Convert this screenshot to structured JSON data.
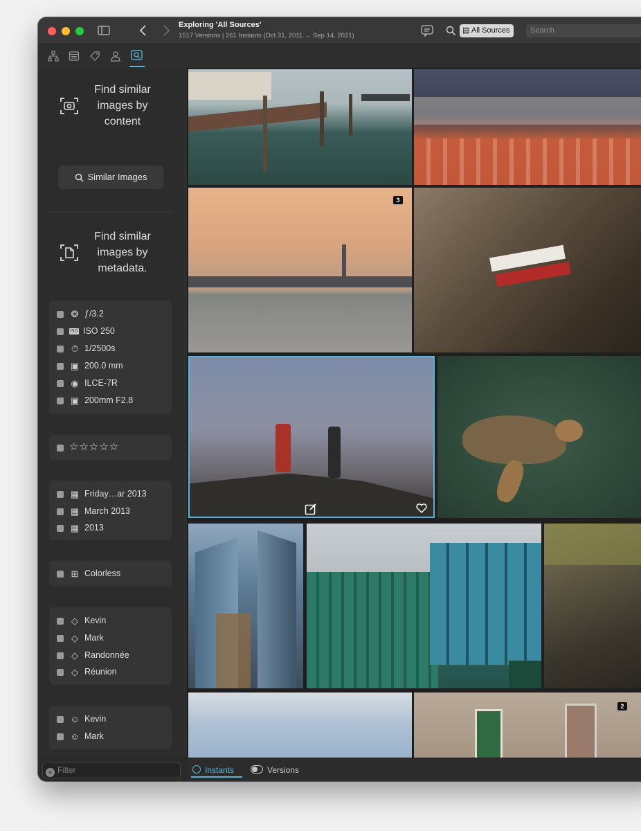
{
  "window": {
    "title": "Exploring 'All Sources'",
    "subtitle": "1517 Versions | 261 Instants (Oct 31, 2011 → Sep 14, 2021)",
    "source_label": "All Sources",
    "search_placeholder": "Search"
  },
  "sidebar": {
    "content_hint": "Find similar images by content",
    "similar_button": "Similar Images",
    "metadata_hint": "Find similar images by metadata.",
    "exif": [
      {
        "icon": "aperture-icon",
        "label": "ƒ/3.2"
      },
      {
        "icon": "iso-icon",
        "label": "ISO 250"
      },
      {
        "icon": "timer-icon",
        "label": "1/2500s"
      },
      {
        "icon": "focal-length-icon",
        "label": "200.0 mm"
      },
      {
        "icon": "camera-icon",
        "label": "ILCE-7R"
      },
      {
        "icon": "lens-icon",
        "label": "200mm F2.8"
      }
    ],
    "rating": "☆☆☆☆☆",
    "dates": [
      "Friday…ar 2013",
      "March 2013",
      "2013"
    ],
    "color": "Colorless",
    "keywords": [
      "Kevin",
      "Mark",
      "Randonnée",
      "Réunion"
    ],
    "people": [
      "Kevin",
      "Mark"
    ],
    "filter_placeholder": "Filter"
  },
  "grid": {
    "badges": {
      "sunset": "3",
      "door": "2"
    }
  },
  "bottom": {
    "instants_label": "Instants",
    "versions_label": "Versions"
  },
  "colors": {
    "accent": "#5ab4d6",
    "window_bg": "#2a2a2a",
    "sidebar_group": "#353535"
  }
}
